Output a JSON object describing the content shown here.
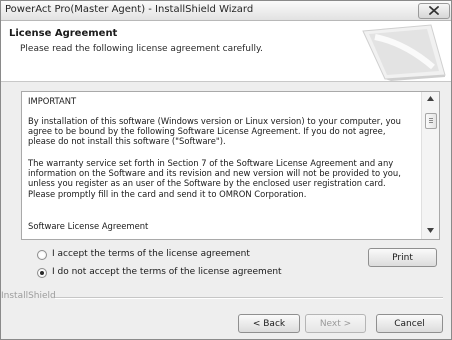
{
  "window": {
    "title": "PowerAct Pro(Master Agent) - InstallShield Wizard"
  },
  "header": {
    "title": "License Agreement",
    "subtitle": "Please read the following license agreement carefully."
  },
  "license": {
    "paragraphs": [
      "IMPORTANT",
      "By installation of this software (Windows version or Linux version) to your computer, you agree to be bound by the following Software License Agreement. If you do not agree, please do not install this software (\"Software\").",
      "The warranty service set forth in Section 7 of the Software License Agreement and any information on the Software and its revision and new version will not be provided to you, unless you register as an user of the Software by the enclosed user registration card. Please promptly fill in the card and send it to OMRON Corporation.",
      "Software License Agreement"
    ]
  },
  "options": {
    "accept_label": "I accept the terms of the license agreement",
    "decline_label": "I do not accept the terms of the license agreement",
    "selected": "decline"
  },
  "buttons": {
    "print": "Print",
    "back": "< Back",
    "next": "Next >",
    "cancel": "Cancel"
  },
  "brand": "InstallShield",
  "icons": {
    "close": "close-x-icon",
    "scroll_up": "scroll-up-arrow-icon",
    "scroll_down": "scroll-down-arrow-icon",
    "header_graphic": "computer-screen-graphic"
  }
}
